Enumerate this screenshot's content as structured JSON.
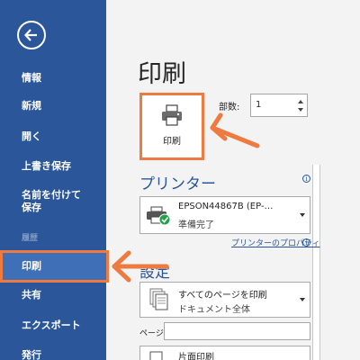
{
  "sidebar": {
    "back_icon": "back-arrow-icon",
    "items": [
      {
        "label": "情報"
      },
      {
        "label": "新規"
      },
      {
        "label": "開く"
      },
      {
        "label": "上書き保存"
      },
      {
        "label": "名前を付けて保存"
      },
      {
        "label": "履歴"
      },
      {
        "label": "印刷"
      },
      {
        "label": "共有"
      },
      {
        "label": "エクスポート"
      },
      {
        "label": "発行"
      }
    ]
  },
  "main": {
    "title": "印刷",
    "print_button_label": "印刷",
    "copies_label": "部数:",
    "copies_value": "1",
    "printer_heading": "プリンター",
    "printer_name": "EPSON44867B (EP-…",
    "printer_status": "準備完了",
    "printer_properties_link": "プリンターのプロパティ",
    "settings_heading": "設定",
    "scope_line1": "すべてのページを印刷",
    "scope_line2": "ドキュメント全体",
    "pages_label": "ページ:",
    "sides_line1": "片面印刷"
  },
  "colors": {
    "sidebar_bg": "#2b579a",
    "sidebar_selected": "#3f6fb6",
    "main_bg": "#f3f3f3",
    "accent_heading": "#2b579a",
    "annotation": "#ef7a40",
    "ready_check": "#22a14a"
  }
}
